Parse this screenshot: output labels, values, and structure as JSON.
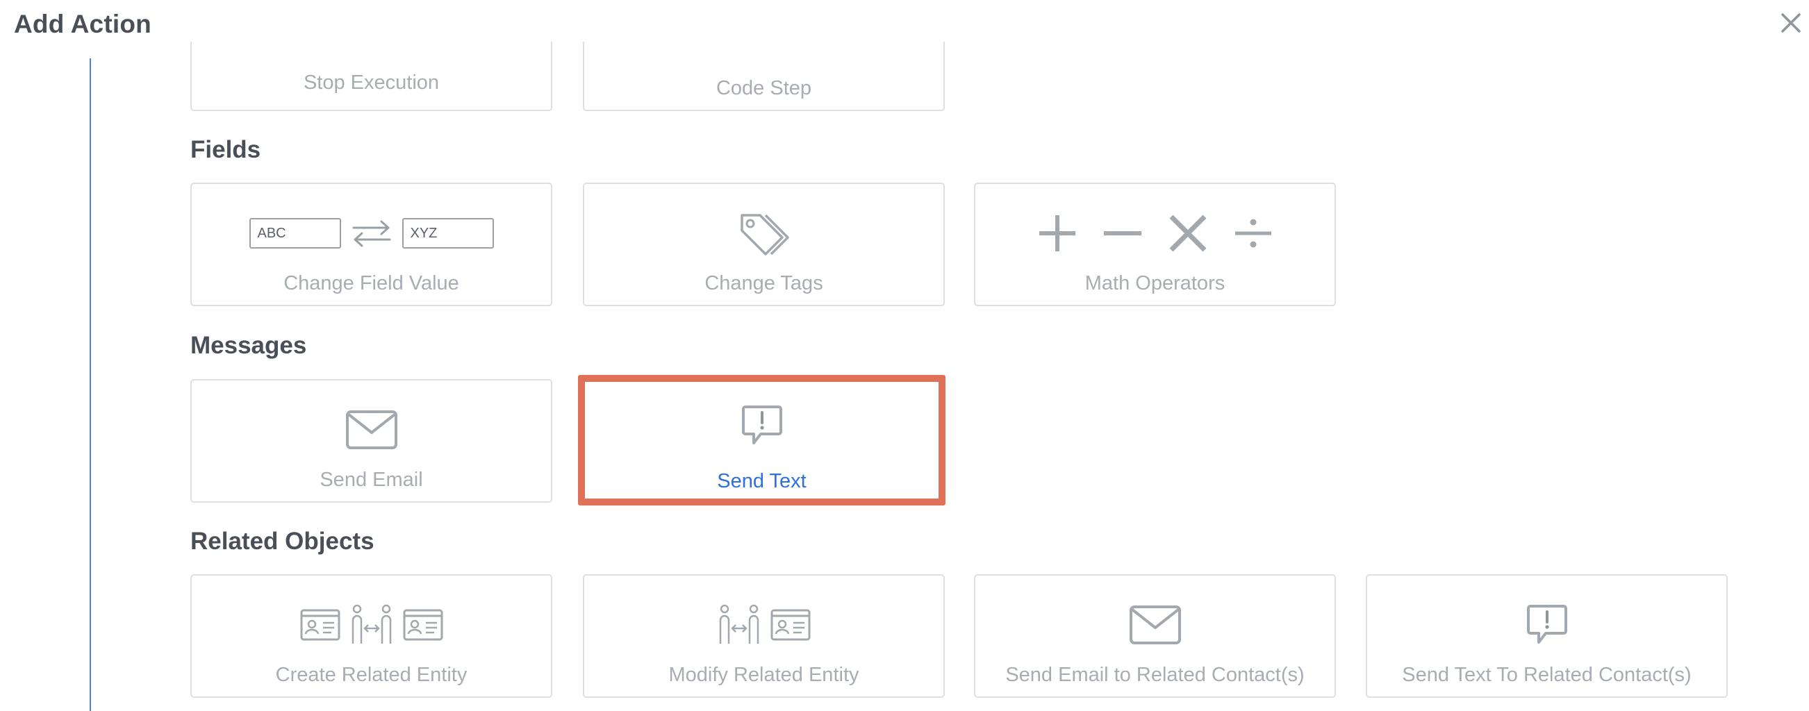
{
  "header": {
    "title": "Add Action"
  },
  "top_row": {
    "stop_execution": "Stop Execution",
    "code_step": "Code Step"
  },
  "sections": {
    "fields": {
      "title": "Fields",
      "change_field_value": {
        "label": "Change Field Value",
        "box_left": "ABC",
        "box_right": "XYZ"
      },
      "change_tags": {
        "label": "Change Tags"
      },
      "math_operators": {
        "label": "Math Operators"
      }
    },
    "messages": {
      "title": "Messages",
      "send_email": {
        "label": "Send Email"
      },
      "send_text": {
        "label": "Send Text",
        "selected": true
      }
    },
    "related_objects": {
      "title": "Related Objects",
      "create_related_entity": {
        "label": "Create Related Entity"
      },
      "modify_related_entity": {
        "label": "Modify Related Entity"
      },
      "send_email_related": {
        "label": "Send Email to Related Contact(s)"
      },
      "send_text_related": {
        "label": "Send Text To Related Contact(s)"
      }
    }
  },
  "colors": {
    "accent_blue": "#2f6fe0",
    "selection_border": "#e07158",
    "timeline": "#4f7ce6",
    "icon_gray": "#a8adb3"
  },
  "icons": {
    "close": "close-icon",
    "swap": "swap-arrows-icon",
    "tags": "tags-icon",
    "math": [
      "plus-icon",
      "minus-icon",
      "times-icon",
      "divide-icon"
    ],
    "email": "envelope-icon",
    "text": "message-alert-icon",
    "contact_card": "contact-card-icon",
    "people_link": "people-link-icon"
  }
}
